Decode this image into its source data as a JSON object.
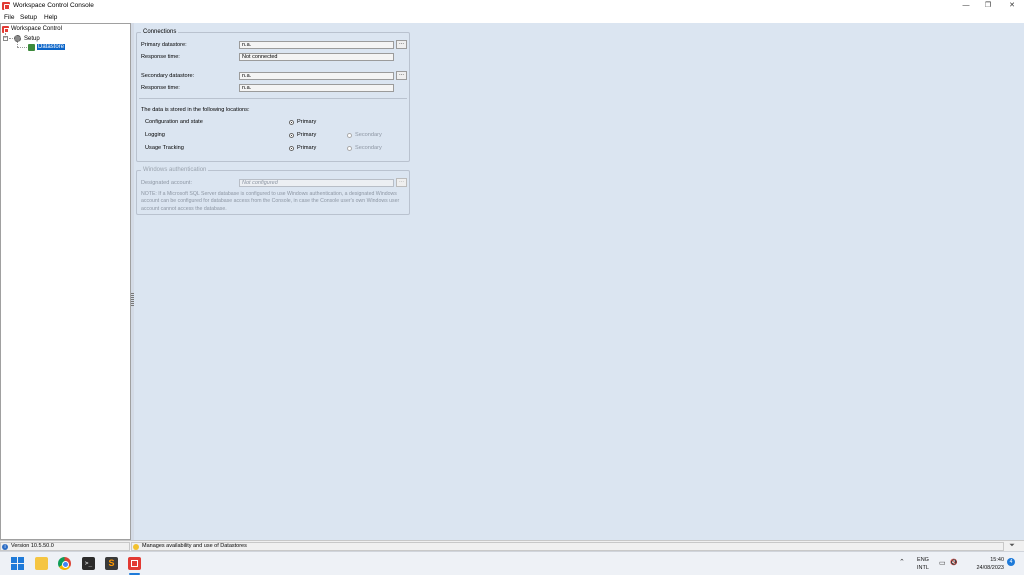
{
  "window": {
    "title": "Workspace Control Console",
    "min_glyph": "—",
    "max_glyph": "❐",
    "close_glyph": "✕"
  },
  "menu": [
    "File",
    "Setup",
    "Help"
  ],
  "tree": {
    "root": "Workspace Control",
    "setup": "Setup",
    "datastore": "Datastore",
    "expander": "−"
  },
  "connections": {
    "legend": "Connections",
    "primary_label": "Primary datastore:",
    "primary_value": "n.a.",
    "primary_response_label": "Response time:",
    "primary_response_value": "Not connected",
    "secondary_label": "Secondary datastore:",
    "secondary_value": "n.a.",
    "secondary_response_label": "Response time:",
    "secondary_response_value": "n.a.",
    "browse_label": "..."
  },
  "locations": {
    "heading": "The data is stored in the following locations:",
    "rows": [
      {
        "label": "Configuration and state",
        "primary": "Primary",
        "secondary": ""
      },
      {
        "label": "Logging",
        "primary": "Primary",
        "secondary": "Secondary"
      },
      {
        "label": "Usage Tracking",
        "primary": "Primary",
        "secondary": "Secondary"
      }
    ]
  },
  "windows_auth": {
    "legend": "Windows authentication",
    "account_label": "Designated account:",
    "account_value": "Not configured",
    "browse_label": "...",
    "note": "NOTE: If a Microsoft SQL Server database is configured to use Windows authentication, a designated Windows account can be configured for database access from the Console, in case the Console user's own Windows user account cannot access the database."
  },
  "status": {
    "version": "Version 10.5.50.0",
    "message": "Manages availability and use of Datastores"
  },
  "taskbar": {
    "terminal_glyph": ">_",
    "sublime_glyph": "S",
    "chevron": "⌃",
    "lang_top": "ENG",
    "lang_bottom": "INTL",
    "time": "15:40",
    "date": "24/08/2023",
    "notifications": "4",
    "display_glyph": "▭",
    "volume_glyph": "🔇"
  },
  "colors": {
    "accent": "#0a64c8",
    "brand": "#e23a33",
    "panel_bg": "#dbe5f1"
  }
}
